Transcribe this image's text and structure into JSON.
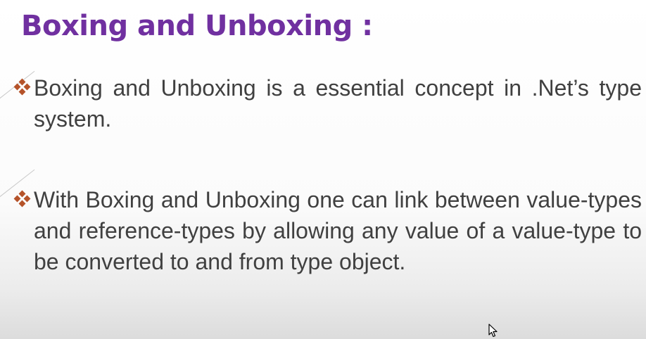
{
  "slide": {
    "title": "Boxing and Unboxing  :",
    "bullets": [
      {
        "icon": "diamond-bullet-icon",
        "text": "Boxing and Unboxing is a  essential concept in .Net’s type system."
      },
      {
        "icon": "diamond-bullet-icon",
        "text": "With Boxing and Unboxing one can link between value-types and reference-types by allowing any value of a value-type to be converted to and from type object."
      }
    ]
  },
  "colors": {
    "title": "#7030a0",
    "body_text": "#404040",
    "bullet": "#b5532a",
    "background": "#ffffff"
  },
  "icons": {
    "cursor": "mouse-pointer-icon"
  }
}
